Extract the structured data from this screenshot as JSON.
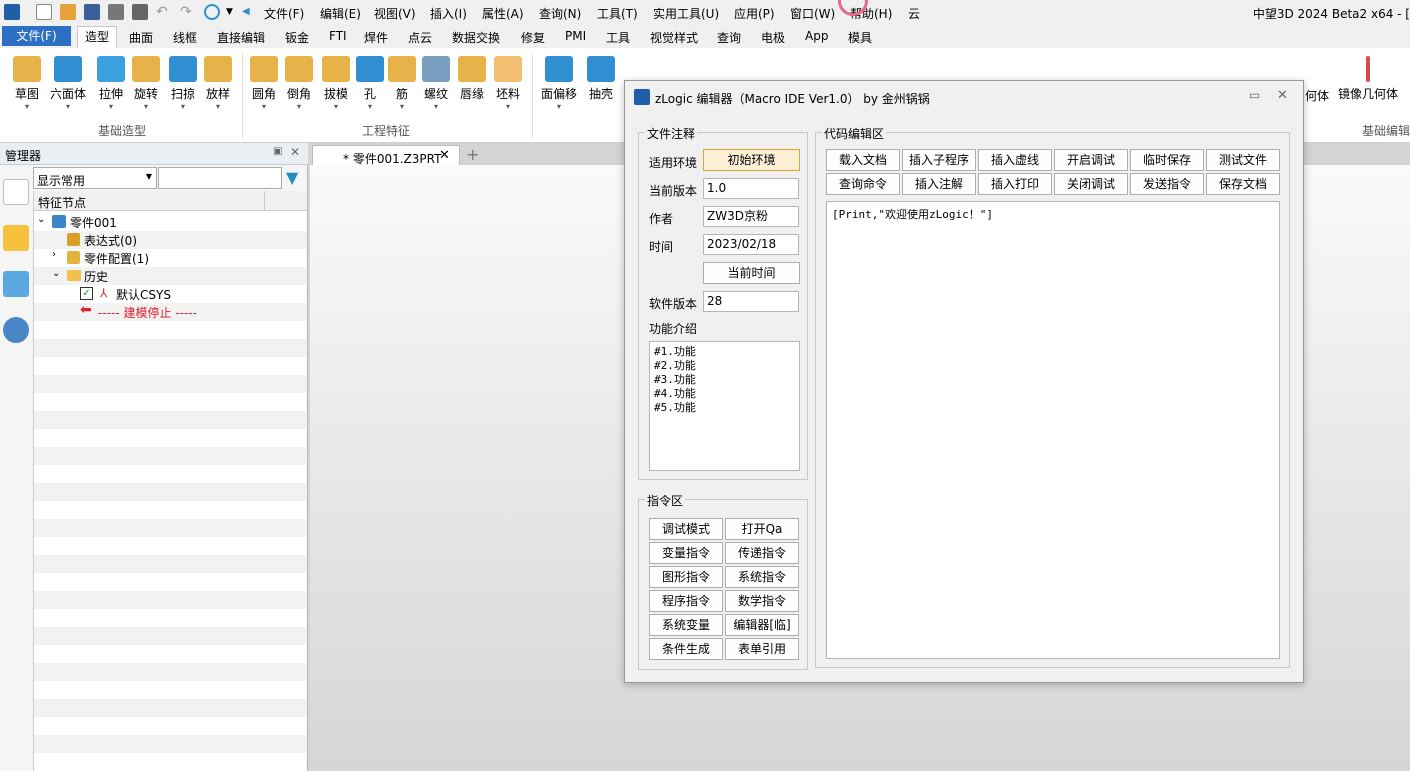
{
  "app_title": "中望3D 2024 Beta2 x64 - [",
  "menu": [
    "文件(F)",
    "编辑(E)",
    "视图(V)",
    "插入(I)",
    "属性(A)",
    "查询(N)",
    "工具(T)",
    "实用工具(U)",
    "应用(P)",
    "窗口(W)",
    "帮助(H)",
    "云"
  ],
  "file_tab": "文件(F)",
  "ribbon_tabs": [
    "造型",
    "曲面",
    "线框",
    "直接编辑",
    "钣金",
    "FTI",
    "焊件",
    "点云",
    "数据交换",
    "修复",
    "PMI",
    "工具",
    "视觉样式",
    "查询",
    "电极",
    "App",
    "模具"
  ],
  "ribbon": {
    "basic": [
      "草图",
      "六面体",
      "拉伸",
      "旋转",
      "扫掠",
      "放样"
    ],
    "basic_label": "基础造型",
    "eng": [
      "圆角",
      "倒角",
      "拔模",
      "孔",
      "筋",
      "螺纹",
      "唇缘",
      "坯料"
    ],
    "eng_label": "工程特征",
    "more": [
      "面偏移",
      "抽壳"
    ],
    "right": [
      "何体",
      "镜像几何体"
    ],
    "right_label": "基础编辑"
  },
  "manager": {
    "title": "管理器",
    "filter_value": "显示常用",
    "column": "特征节点",
    "nodes": [
      "零件001",
      "表达式(0)",
      "零件配置(1)",
      "历史",
      "默认CSYS",
      "----- 建模停止 -----"
    ]
  },
  "doc_tab": "* 零件001.Z3PRT",
  "dialog": {
    "title": "zLogic 编辑器（Macro IDE Ver1.0） by 金州锅锅",
    "file_notes": {
      "title": "文件注释",
      "env_label": "适用环境",
      "env_button": "初始环境",
      "version_label": "当前版本",
      "version": "1.0",
      "author_label": "作者",
      "author": "ZW3D京粉",
      "time_label": "时间",
      "time": "2023/02/18",
      "now_button": "当前时间",
      "sw_label": "软件版本",
      "sw_version": "28",
      "intro_label": "功能介绍",
      "intro_lines": [
        "#1.功能",
        "#2.功能",
        "#3.功能",
        "#4.功能",
        "#5.功能"
      ]
    },
    "commands": {
      "title": "指令区",
      "buttons": [
        "调试模式",
        "打开Qa",
        "变量指令",
        "传递指令",
        "图形指令",
        "系统指令",
        "程序指令",
        "数学指令",
        "系统变量",
        "编辑器[临]",
        "条件生成",
        "表单引用"
      ]
    },
    "code": {
      "title": "代码编辑区",
      "buttons": [
        "载入文档",
        "插入子程序",
        "插入虚线",
        "开启调试",
        "临时保存",
        "测试文件",
        "查询命令",
        "插入注解",
        "插入打印",
        "关闭调试",
        "发送指令",
        "保存文档"
      ],
      "content": "[Print,\"欢迎使用zLogic！\"]"
    }
  },
  "colors": {
    "file_tab": "#2d6fc3",
    "accent_icon": "#2f8fd0",
    "stop_red": "#e0202a"
  }
}
